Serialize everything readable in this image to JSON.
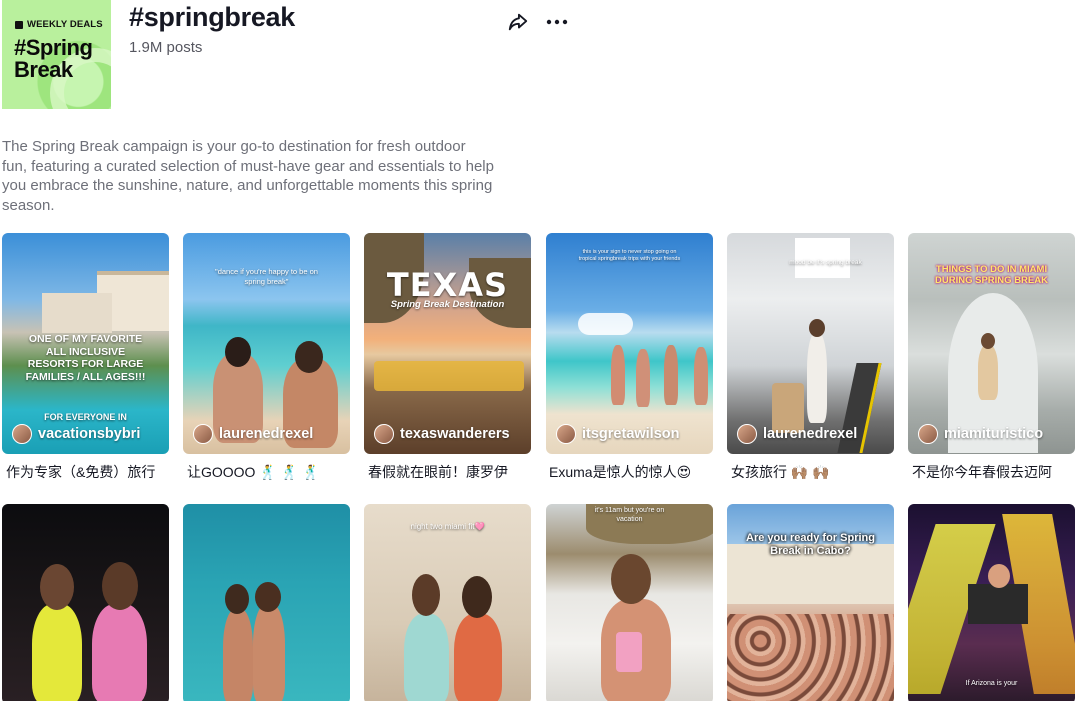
{
  "header": {
    "cover_badge": "WEEKLY DEALS",
    "cover_title": "#Spring Break",
    "title": "#springbreak",
    "posts": "1.9M posts",
    "description": "The Spring Break campaign is your go-to destination for fresh outdoor fun, featuring a curated selection of must-have gear and essentials to help you embrace the sunshine, nature, and unforgettable moments this spring season.",
    "icons": [
      "share-icon",
      "more-icon"
    ]
  },
  "row1": [
    {
      "user": "vacationsbybri",
      "overlay": "ONE OF MY FAVORITE ALL INCLUSIVE RESORTS FOR LARGE FAMILIES / ALL AGES!!!",
      "overlay2": "FOR EVERYONE IN",
      "caption": "作为专家（&免费）旅行"
    },
    {
      "user": "laurenedrexel",
      "overlay": "\"dance if you're happy to be on spring break\"",
      "caption": "让GOOOO 🕺 🕺 🕺"
    },
    {
      "user": "texaswanderers",
      "overlay": "TEXAS",
      "overlay2": "Spring Break Destination",
      "caption": "春假就在眼前！康罗伊"
    },
    {
      "user": "itsgretawilson",
      "overlay": "this is your sign to never stop going on tropical springbreak trips with your friends",
      "caption": "Exuma是惊人的惊人😍"
    },
    {
      "user": "laurenedrexel",
      "overlay": "mood be it's spring break",
      "caption": "女孩旅行 🙌🏽 🙌🏽"
    },
    {
      "user": "miamituristico",
      "overlay": "THINGS TO DO IN MIAMI DURING SPRING BREAK",
      "caption": "不是你今年春假去迈阿"
    }
  ],
  "row2": [
    {
      "overlay": ""
    },
    {
      "overlay": ""
    },
    {
      "overlay": "night two miami fit🩷"
    },
    {
      "overlay": "it's 11am but you're on vacation"
    },
    {
      "overlay": "Are you ready for Spring Break in Cabo?"
    },
    {
      "overlay": "If Arizona is your"
    }
  ]
}
